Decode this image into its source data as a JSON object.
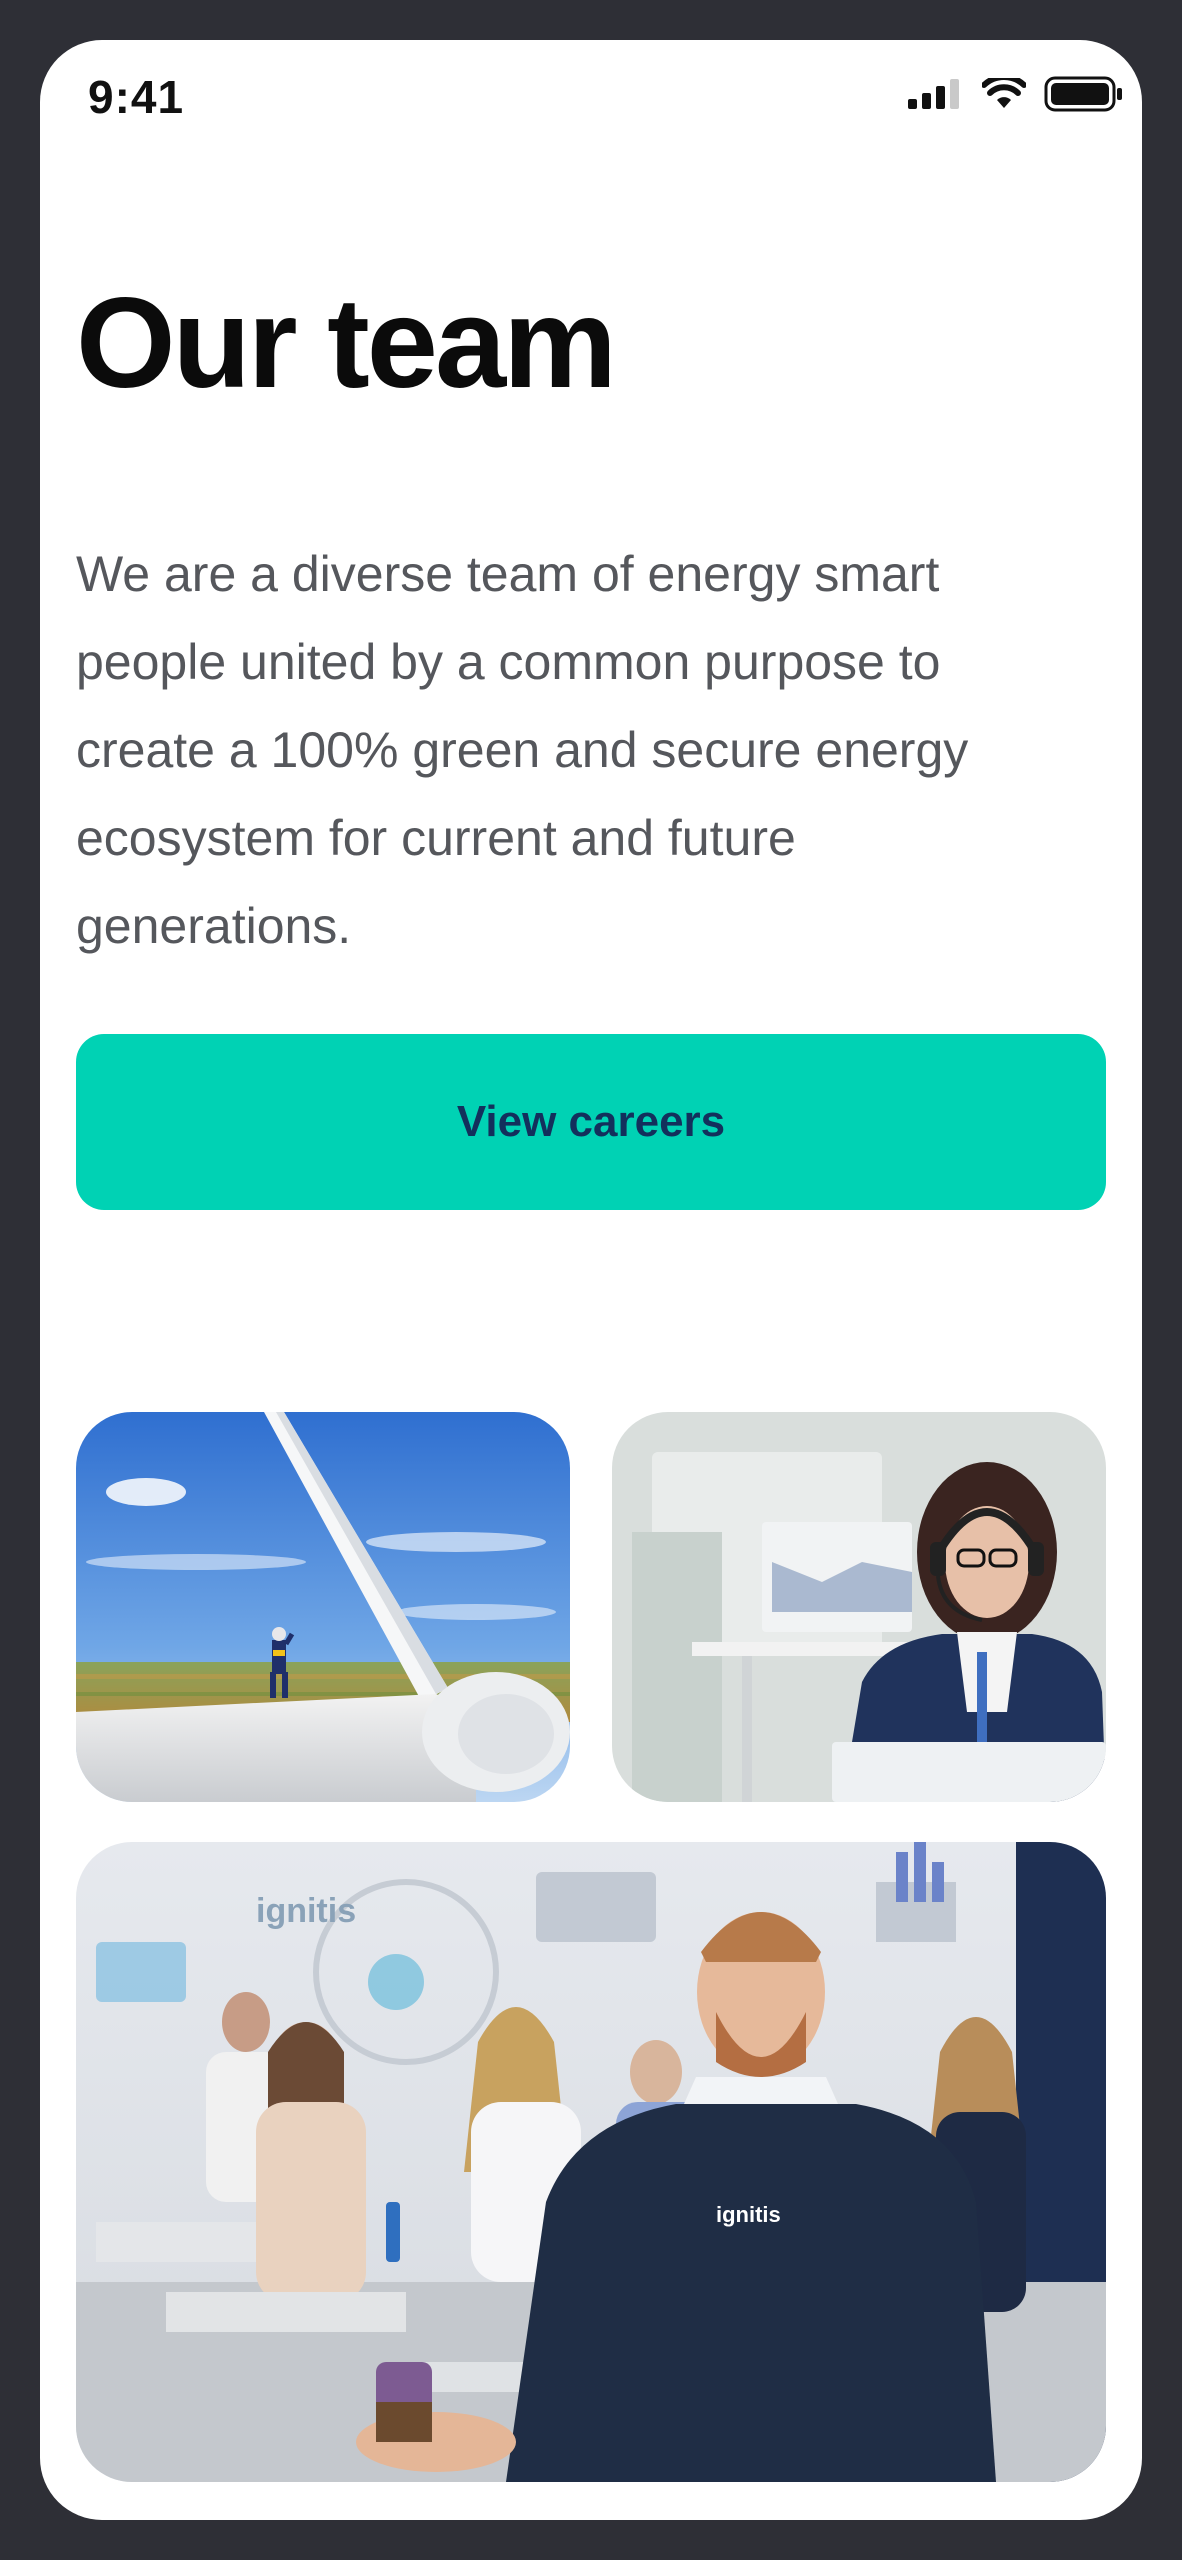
{
  "status_bar": {
    "time": "9:41",
    "icons": [
      "signal-icon",
      "wifi-icon",
      "battery-icon"
    ]
  },
  "page": {
    "title": "Our team",
    "intro": "We are a diverse team of energy smart people united by a common purpose to create a 100% green and secure energy ecosystem for current and future generations."
  },
  "cta": {
    "label": "View careers",
    "color": "#00d2b4",
    "text_color": "#13305c"
  },
  "photos": [
    {
      "name": "wind-turbine-worker-photo"
    },
    {
      "name": "call-center-agent-photo"
    },
    {
      "name": "team-meeting-photo",
      "wall_logo_text": "ignitis",
      "sweater_logo_text": "ignitis"
    }
  ]
}
